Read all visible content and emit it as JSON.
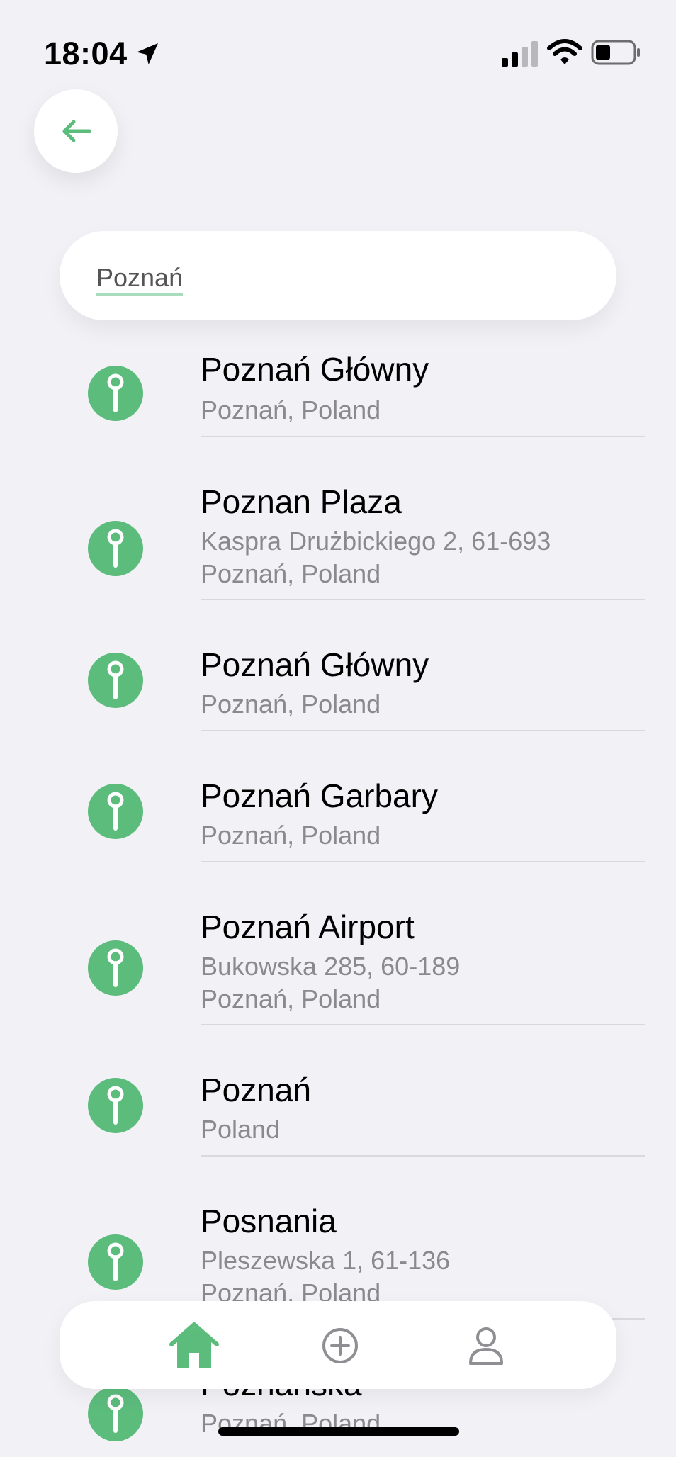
{
  "status_bar": {
    "time": "18:04"
  },
  "search": {
    "value": "Poznań"
  },
  "results": [
    {
      "title": "Poznań Główny",
      "lines": [
        "Poznań, Poland"
      ]
    },
    {
      "title": "Poznan Plaza",
      "lines": [
        "Kaspra Drużbickiego 2, 61-693",
        "Poznań, Poland"
      ]
    },
    {
      "title": "Poznań Główny",
      "lines": [
        "Poznań, Poland"
      ]
    },
    {
      "title": "Poznań Garbary",
      "lines": [
        "Poznań, Poland"
      ]
    },
    {
      "title": "Poznań Airport",
      "lines": [
        "Bukowska 285, 60-189",
        "Poznań, Poland"
      ]
    },
    {
      "title": "Poznań",
      "lines": [
        "Poland"
      ]
    },
    {
      "title": "Posnania",
      "lines": [
        "Pleszewska 1, 61-136",
        "Poznań, Poland"
      ]
    },
    {
      "title": "Poznańska",
      "lines": [
        "Poznań, Poland"
      ]
    }
  ],
  "tab_bar": {
    "tabs": [
      "home-icon",
      "add-circle-icon",
      "profile-icon"
    ],
    "active": "home-icon"
  },
  "colors": {
    "accent": "#5cbc7c",
    "background": "#f1f1f6",
    "secondary_text": "#8a8a8e"
  }
}
